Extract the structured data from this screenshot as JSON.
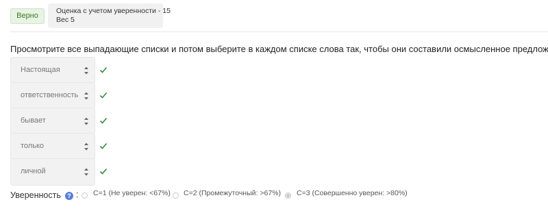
{
  "status": {
    "label": "Верно",
    "color": "#3f7a28"
  },
  "score": {
    "line1": "Оценка с учетом уверенности - 15",
    "line2": "Вес 5"
  },
  "question": {
    "text": "Просмотрите все выпадающие списки и потом выберите в каждом списке слова так, чтобы они составили осмысленное предложение:"
  },
  "dropdowns": [
    {
      "value": "Настоящая",
      "correct": true
    },
    {
      "value": "ответственность",
      "correct": true
    },
    {
      "value": "бывает",
      "correct": true
    },
    {
      "value": "только",
      "correct": true
    },
    {
      "value": "личной",
      "correct": true
    }
  ],
  "confidence": {
    "label": "Уверенность",
    "help_icon": "question-circle-icon",
    "separator": ":",
    "options": [
      {
        "label": "C=1 (Не уверен: <67%)",
        "selected": false
      },
      {
        "label": "C=2 (Промежуточный: >67%)",
        "selected": false
      },
      {
        "label": "C=3 (Совершенно уверен: >80%)",
        "selected": true
      }
    ]
  },
  "colors": {
    "check": "#2e8b3e",
    "help": "#5b7fd6"
  }
}
